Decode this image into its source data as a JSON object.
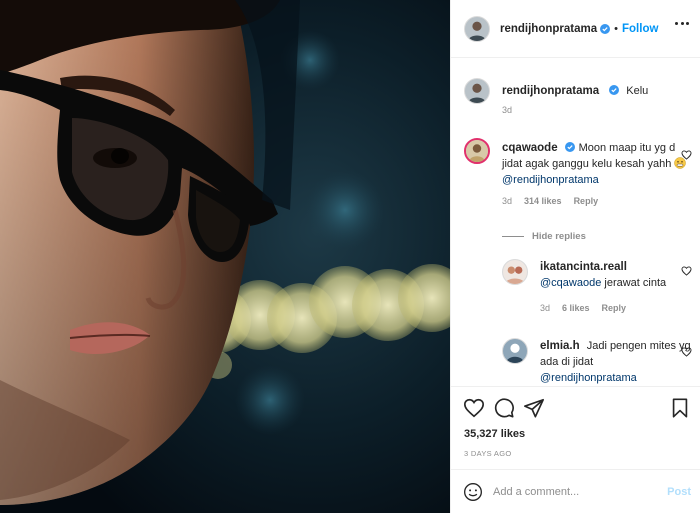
{
  "post_image": {
    "description_icon": "photo-of-man-with-glasses-and-bokeh-lights"
  },
  "header": {
    "username": "rendijhonpratama",
    "separator": "•",
    "follow_label": "Follow",
    "more_icon": "more-options-icon"
  },
  "caption": {
    "username": "rendijhonpratama",
    "text": "Kelu",
    "time": "3d"
  },
  "comments": [
    {
      "username": "cqawaode",
      "text": "Moon maap itu yg d jidat agak ganggu kelu kesah yahh",
      "emoji": "grimace-emoji",
      "mention": "@rendijhonpratama",
      "time": "3d",
      "likes": "314 likes",
      "reply_label": "Reply"
    }
  ],
  "hide_replies_label": "Hide replies",
  "replies": [
    {
      "username": "ikatancinta.reall",
      "mention": "@cqawaode",
      "text": "jerawat cinta",
      "time": "3d",
      "likes": "6 likes",
      "reply_label": "Reply"
    },
    {
      "username": "elmia.h",
      "text": "Jadi pengen mites yg ada di jidat",
      "mention": "@rendijhonpratama"
    }
  ],
  "actions": {
    "like_icon": "heart-icon",
    "comment_icon": "comment-icon",
    "share_icon": "share-icon",
    "save_icon": "bookmark-icon",
    "likes_count": "35,327 likes",
    "date": "3 DAYS AGO"
  },
  "add_comment": {
    "placeholder": "Add a comment...",
    "post_label": "Post"
  },
  "colors": {
    "accent_blue": "#0095f6",
    "verified_blue": "#3897f0",
    "muted": "#8e8e8e",
    "post_disabled": "#b2dffc"
  }
}
